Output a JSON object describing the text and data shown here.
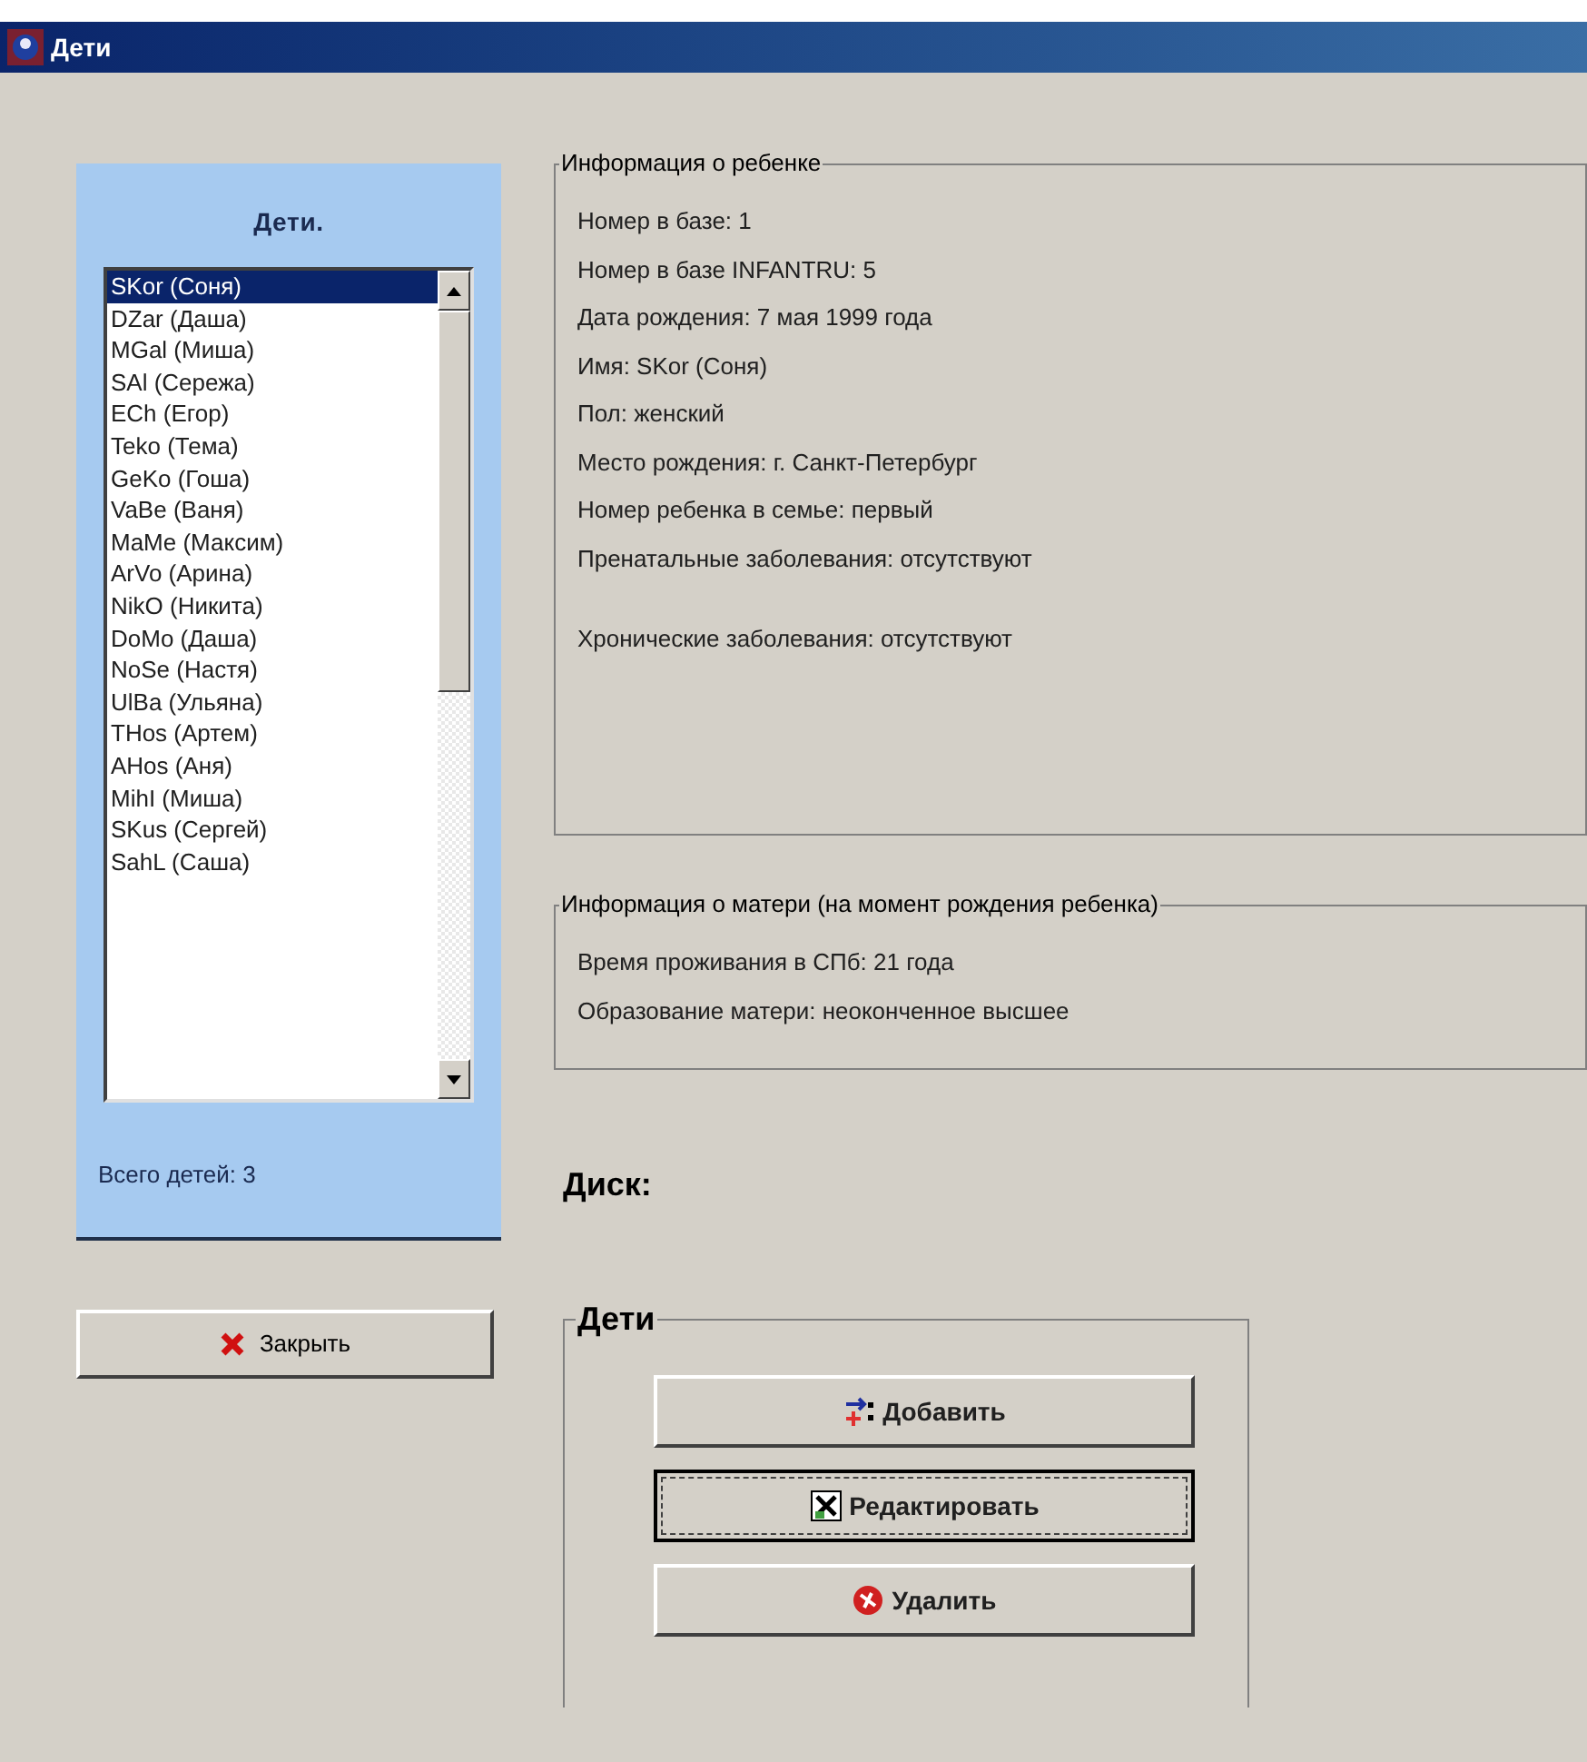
{
  "window": {
    "title": "Дети"
  },
  "children_panel": {
    "title": "Дети.",
    "items": [
      {
        "label": "SKor (Соня)",
        "selected": true
      },
      {
        "label": "DZar (Даша)",
        "selected": false
      },
      {
        "label": "MGal (Миша)",
        "selected": false
      },
      {
        "label": "SAl (Сережа)",
        "selected": false
      },
      {
        "label": "ECh (Егор)",
        "selected": false
      },
      {
        "label": "Teko (Тема)",
        "selected": false
      },
      {
        "label": "GeKo (Гоша)",
        "selected": false
      },
      {
        "label": "VaBe (Ваня)",
        "selected": false
      },
      {
        "label": "MaMe (Максим)",
        "selected": false
      },
      {
        "label": "ArVo (Арина)",
        "selected": false
      },
      {
        "label": "NikO (Никита)",
        "selected": false
      },
      {
        "label": "DoMo (Даша)",
        "selected": false
      },
      {
        "label": "NoSe (Настя)",
        "selected": false
      },
      {
        "label": "UlBa (Ульяна)",
        "selected": false
      },
      {
        "label": "THos (Артем)",
        "selected": false
      },
      {
        "label": "AHos (Аня)",
        "selected": false
      },
      {
        "label": "MihI (Миша)",
        "selected": false
      },
      {
        "label": "SKus (Сергей)",
        "selected": false
      },
      {
        "label": "SahL (Саша)",
        "selected": false
      }
    ],
    "total": "Всего детей: 3"
  },
  "close_button": {
    "label": "Закрыть"
  },
  "child_info": {
    "title": "Информация о ребенке",
    "lines": [
      "Номер в базе: 1",
      "Номер в базе INFANTRU: 5",
      "Дата рождения: 7 мая 1999 года",
      "Имя: SKor (Соня)",
      "Пол: женский",
      "Место рождения: г. Санкт-Петербург",
      "Номер ребенка в семье: первый",
      "Пренатальные заболевания: отсутствуют",
      "Хронические заболевания: отсутствуют"
    ]
  },
  "mother_info": {
    "title": "Информация о матери (на момент рождения ребенка)",
    "lines": [
      "Время проживания в СПб: 21 года",
      "Образование матери: неоконченное высшее"
    ]
  },
  "disk_label": "Диск:",
  "children_group": {
    "title": "Дети",
    "buttons": [
      {
        "kind": "add",
        "label": "Добавить",
        "focused": false
      },
      {
        "kind": "edit",
        "label": "Редактировать",
        "focused": true
      },
      {
        "kind": "delete",
        "label": "Удалить",
        "focused": false
      }
    ]
  }
}
